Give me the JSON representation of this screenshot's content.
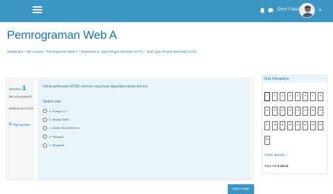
{
  "topbar": {
    "menu_icon": "hamburger-icon",
    "notification_icon": "bell-icon",
    "messages_icon": "chat-icon",
    "username": "Dhm Faisal",
    "user_menu_icon": "caret-down-icon",
    "color": "#3b96c4"
  },
  "page": {
    "title": "Pemrograman Web A"
  },
  "breadcrumb": {
    "items": [
      "Dashboard",
      "My courses",
      "Pemrograman Web A",
      "Pertemuan 8. Ujian Tengah Semester (UTS)",
      "Soal Ujian Tengah Semester (UTS)"
    ],
    "separator": "/"
  },
  "question": {
    "label": "Question",
    "number": "1",
    "state": "Not yet answered",
    "grade": "Marked out of 4.00",
    "flag_label": "Flag question",
    "text": "Dalam pembuatan HTML software yang biasa digunakan adalah Kecuali",
    "select_label": "Select one:",
    "options": [
      "a. Notepad ++",
      "b. Semua Salah",
      "c. Adobe DreamWeaver",
      "d. Notepad",
      "e. Wordpad"
    ]
  },
  "next_page_label": "NEXT PAGE",
  "quiz_nav": {
    "title": "Quiz Navigation",
    "buttons": [
      "1",
      "2",
      "3",
      "4",
      "5",
      "6",
      "7",
      "8",
      "9",
      "10",
      "11",
      "12",
      "13",
      "14",
      "15",
      "16",
      "17",
      "18",
      "19",
      "20",
      "21",
      "22",
      "23",
      "24",
      "25"
    ],
    "finish_label": "Finish attempt ...",
    "time_label": "Time left",
    "time_value": "0:28:41"
  }
}
